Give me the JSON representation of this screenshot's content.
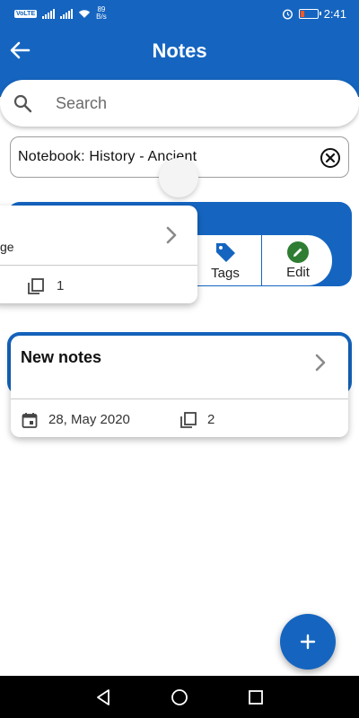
{
  "status_bar": {
    "network_badge": "VoLTE",
    "speed_value": "89",
    "speed_unit": "B/s",
    "time": "2:41"
  },
  "header": {
    "title": "Notes"
  },
  "search": {
    "placeholder": "Search",
    "value": ""
  },
  "filter": {
    "label": "Notebook: History - Ancient"
  },
  "notes": [
    {
      "title_fragment": "ge",
      "page_count": "1",
      "actions": [
        {
          "label": "Tags",
          "icon": "tag-icon"
        },
        {
          "label": "Edit",
          "icon": "pencil-icon"
        }
      ]
    },
    {
      "title": "New notes",
      "date": "28, May 2020",
      "page_count": "2"
    }
  ],
  "colors": {
    "primary": "#1565c0",
    "edit_green": "#2e7d32",
    "background": "#ffffff",
    "nav_bar": "#000000"
  }
}
